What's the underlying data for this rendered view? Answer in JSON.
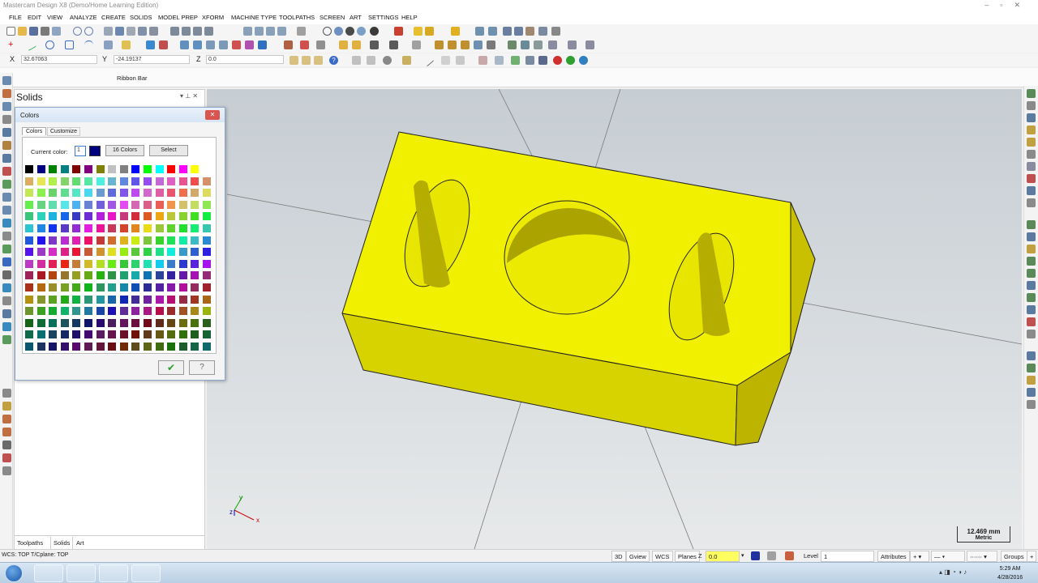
{
  "window": {
    "title": "Mastercam Design X8 (Demo/Home Learning Edition)"
  },
  "menu": [
    "FILE",
    "EDIT",
    "VIEW",
    "ANALYZE",
    "CREATE",
    "SOLIDS",
    "MODEL PREP",
    "XFORM",
    "MACHINE TYPE",
    "TOOLPATHS",
    "SCREEN",
    "ART",
    "SETTINGS",
    "HELP"
  ],
  "coords": {
    "x_label": "X",
    "x_value": "32.67063",
    "y_label": "Y",
    "y_value": "-24.19137",
    "z_label": "Z",
    "z_value": "0.0"
  },
  "ribbon": {
    "label": "Ribbon Bar"
  },
  "panel": {
    "title": "Solids",
    "tabs": [
      "Toolpaths",
      "Solids",
      "Art"
    ]
  },
  "dialog": {
    "title": "Colors",
    "tabs": [
      "Colors",
      "Customize"
    ],
    "current_color_label": "Current color:",
    "current_color_value": "1",
    "btn_16colors": "16 Colors",
    "btn_select": "Select"
  },
  "viewport": {
    "scale_value": "12.469 mm",
    "scale_units": "Metric",
    "axis_y": "y",
    "axis_x": "x",
    "axis_z": "z"
  },
  "status": {
    "wcs_text": "WCS: TOP  T/Cplane: TOP",
    "items": [
      "3D",
      "Gview",
      "WCS",
      "Planes"
    ],
    "z_label": "Z",
    "z_value": "0.0",
    "level_label": "Level",
    "level_value": "1",
    "attributes": "Attributes",
    "groups": "Groups"
  },
  "taskbar": {
    "time": "5:29 AM",
    "date": "4/28/2016"
  },
  "colors": {
    "accent": "#0000ff",
    "part": "#f0f000",
    "current": "#000080"
  }
}
